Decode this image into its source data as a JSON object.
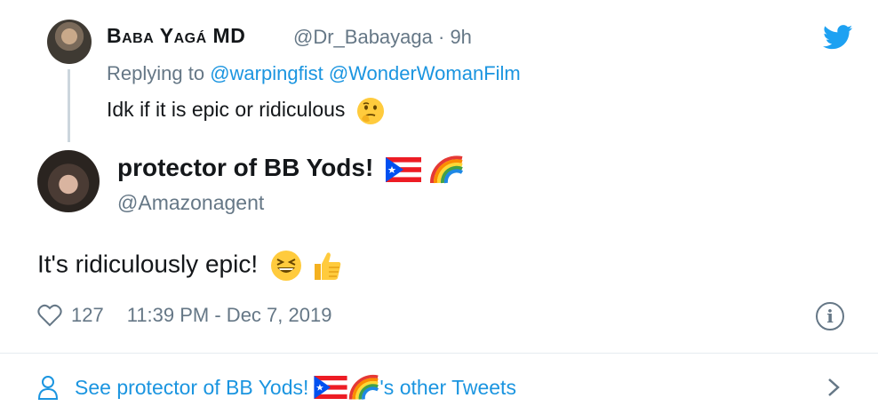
{
  "parent_tweet": {
    "display_name": "Baba Yagá MD",
    "handle": "@Dr_Babayaga",
    "time": "· 9h",
    "replying_prefix": "Replying to",
    "mention_1": "@warpingfist",
    "mention_2": "@WonderWomanFilm",
    "text": "Idk if it is epic or ridiculous",
    "emoji": "thinking-face"
  },
  "main_tweet": {
    "display_name": "protector of BB Yods!",
    "name_emojis": [
      "puerto-rico-flag",
      "rainbow"
    ],
    "handle": "@Amazonagent",
    "text": "It's ridiculously epic!",
    "text_emojis": [
      "grinning-squinting-face",
      "thumbs-up"
    ],
    "likes": "127",
    "timestamp": "11:39 PM - Dec 7, 2019"
  },
  "footer": {
    "see_more_prefix": "See protector of BB Yods!",
    "see_more_suffix": "'s other Tweets"
  },
  "colors": {
    "link": "#1b95e0",
    "muted": "#657786",
    "text": "#14171a",
    "twitter_blue": "#1da1f2"
  }
}
